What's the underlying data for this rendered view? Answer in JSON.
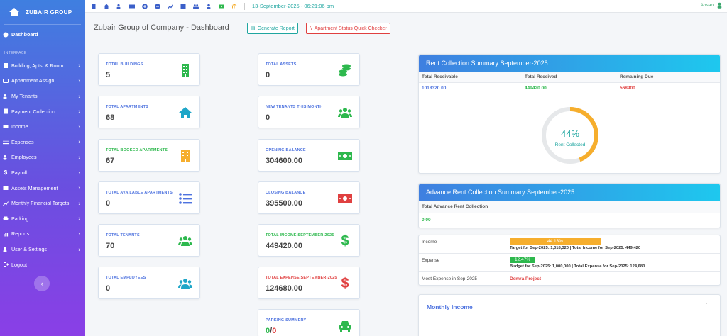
{
  "brand": {
    "name": "ZUBAIR GROUP"
  },
  "sidebar": {
    "dashboard": "Dashboard",
    "heading": "INTERFACE",
    "items": [
      {
        "label": "Building, Apts. & Room",
        "icon": "building-icon"
      },
      {
        "label": "Appartment Assign",
        "icon": "id-card-icon"
      },
      {
        "label": "My Tenants",
        "icon": "users-icon"
      },
      {
        "label": "Payment Collection",
        "icon": "receipt-icon"
      },
      {
        "label": "Income",
        "icon": "cash-icon"
      },
      {
        "label": "Expenses",
        "icon": "list-icon"
      },
      {
        "label": "Employees",
        "icon": "employees-icon"
      },
      {
        "label": "Payroll",
        "icon": "dollar-icon"
      },
      {
        "label": "Assets Management",
        "icon": "assets-icon"
      },
      {
        "label": "Monthly Financial Targets",
        "icon": "chart-icon"
      },
      {
        "label": "Parking",
        "icon": "car-icon"
      },
      {
        "label": "Reports",
        "icon": "report-icon"
      },
      {
        "label": "User & Settings",
        "icon": "user-settings-icon"
      },
      {
        "label": "Logout",
        "icon": "logout-icon"
      }
    ]
  },
  "topbar": {
    "datetime": "13-September-2025 - 06:21:06 pm",
    "user": "Ahsan"
  },
  "page": {
    "title": "Zubair Group of Company - Dashboard",
    "generate_report": "Generate Report",
    "status_checker": "Apartment Status Quick Checker"
  },
  "colors": {
    "accent": "#4e73df",
    "teal": "#1fa6a0",
    "red": "#e04040",
    "green": "#2db84d",
    "orange": "#f6ae2d"
  },
  "cards_left": [
    {
      "label": "TOTAL BUILDINGS",
      "value": "5",
      "icon": "building-icon",
      "color": "#2db84d"
    },
    {
      "label": "TOTAL APARTMENTS",
      "value": "68",
      "icon": "home-icon",
      "color": "#1fa6c8"
    },
    {
      "label": "TOTAL BOOKED APARTMENTS",
      "value": "67",
      "icon": "booked-building-icon",
      "color": "#f6ae2d"
    },
    {
      "label": "TOTAL AVAILABLE APARTMENTS",
      "value": "0",
      "icon": "list-icon",
      "color": "#4e73df"
    },
    {
      "label": "TOTAL TENANTS",
      "value": "70",
      "icon": "users-icon",
      "color": "#2db84d"
    },
    {
      "label": "TOTAL EMPLOYEES",
      "value": "0",
      "icon": "users-icon",
      "color": "#1fa6c8"
    }
  ],
  "cards_right": [
    {
      "label": "TOTAL ASSETS",
      "value": "0",
      "icon": "coins-icon",
      "color": "#2db84d",
      "label_color": "#4e73df"
    },
    {
      "label": "NEW TENANTS THIS MONTH",
      "value": "0",
      "icon": "users-icon",
      "color": "#2db84d",
      "label_color": "#4e73df"
    },
    {
      "label": "OPENING BALANCE",
      "value": "304600.00",
      "icon": "money-bill-icon",
      "color": "#2db84d",
      "label_color": "#4e73df"
    },
    {
      "label": "CLOSING BALANCE",
      "value": "395500.00",
      "icon": "money-bill-icon",
      "color": "#e04040",
      "label_color": "#4e73df"
    },
    {
      "label": "TOTAL INCOME SEPTEMBER-2025",
      "value": "449420.00",
      "icon": "dollar-icon",
      "color": "#2db84d",
      "label_color": "#4e73df"
    },
    {
      "label": "TOTAL EXPENSE SEPTEMBER-2025",
      "value": "124680.00",
      "icon": "dollar-icon",
      "color": "#e04040",
      "label_color": "#e04040"
    },
    {
      "label": "PARKING SUMMERY",
      "value_a": "0",
      "value_sep": "/",
      "value_b": "0",
      "icon": "car-icon",
      "color": "#2db84d",
      "label_color": "#4e73df"
    }
  ],
  "rent_summary": {
    "title": "Rent Collection Summary September-2025",
    "headers": [
      "Total Receivable",
      "Total Received",
      "Remaining Due"
    ],
    "values": [
      "1018320.00",
      "449420.00",
      "568900"
    ],
    "percent_label": "44%",
    "percent": 44,
    "caption": "Rent Collected"
  },
  "advance_summary": {
    "title": "Advance Rent Collection Summary September-2025",
    "header": "Total Advance Rent Collection",
    "value": "0.00"
  },
  "targets": {
    "income_label": "Income",
    "income_pct_text": "44.13%",
    "income_pct": 44.13,
    "income_target_prefix": "Target for Sep-2025: ",
    "income_target_value": "1,018,320",
    "income_total_prefix": " | Total Income for Sep-2025: ",
    "income_total_value": "449,420",
    "expense_label": "Expense",
    "expense_pct_text": "12.47%",
    "expense_pct": 12.47,
    "expense_budget_prefix": "Budget for Sep-2025: ",
    "expense_budget_value": "1,000,000",
    "expense_total_prefix": " | Total Expense for Sep-2025: ",
    "expense_total_value": "124,680",
    "most_expense_label": "Most Expense in Sep-2025",
    "most_expense_value": "Demra Project"
  },
  "monthly_income": {
    "title": "Monthly Income"
  }
}
